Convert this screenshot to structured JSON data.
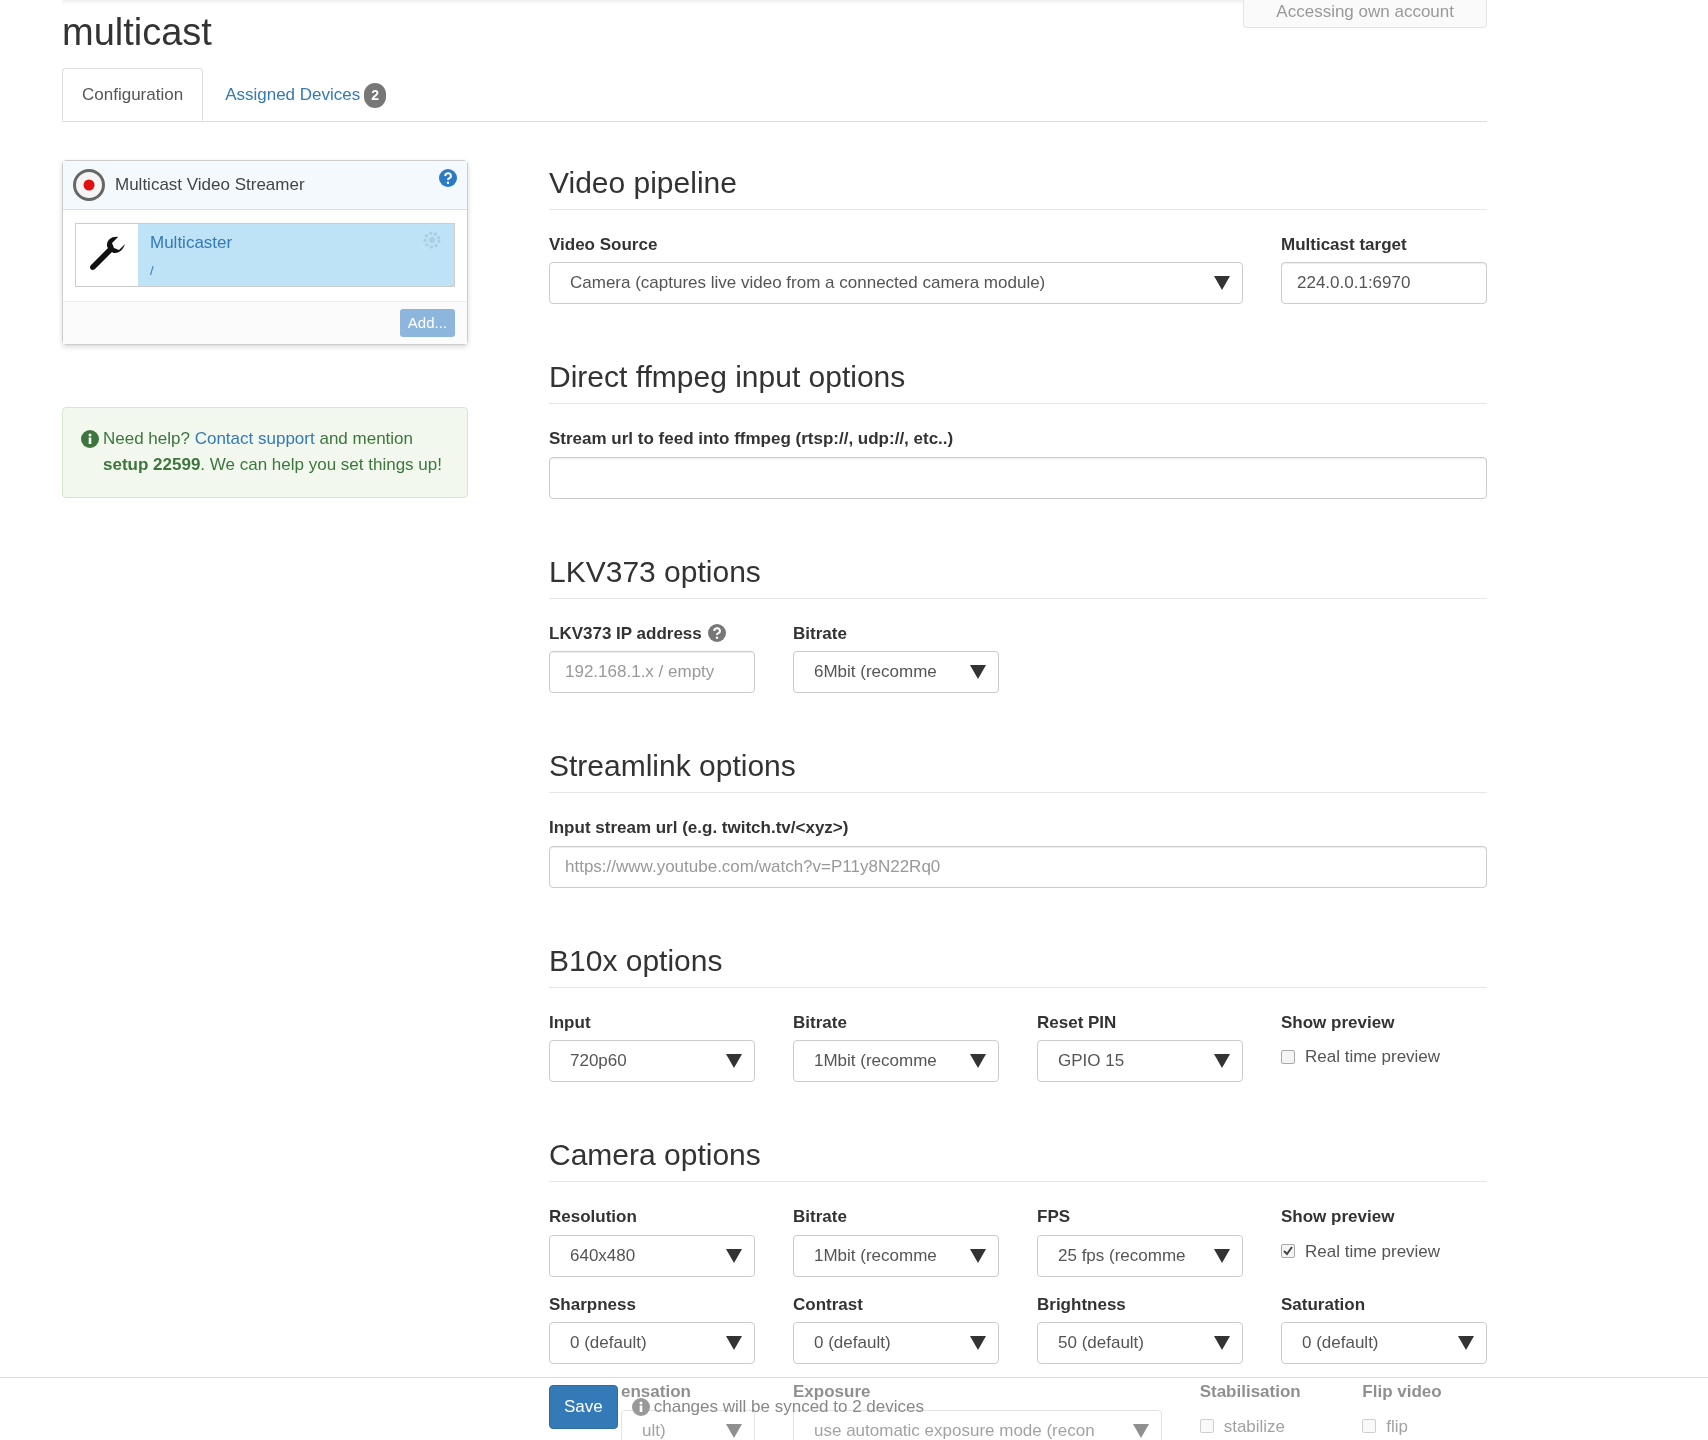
{
  "header": {
    "title": "multicast",
    "account_button": "Accessing own account"
  },
  "tabs": [
    {
      "label": "Configuration",
      "selected": true
    },
    {
      "label": "Assigned Devices",
      "badge": "2",
      "selected": false
    }
  ],
  "app_panel": {
    "title": "Multicast Video Streamer",
    "items": [
      {
        "name": "Multicaster",
        "path": "/",
        "selected": true
      }
    ],
    "add_button": "Add..."
  },
  "help": {
    "lead": "Need help?",
    "link": "Contact support",
    "rest": "and mention **setup 22599**. We can help you set things up!"
  },
  "sections": [
    {
      "title": "Video pipeline",
      "fields": [
        {
          "kind": "wide-select",
          "label": "Video Source",
          "value": "Camera (captures live video from a connected camera module)"
        },
        {
          "kind": "text",
          "label": "Multicast target",
          "value": "224.0.0.1:6970"
        }
      ]
    },
    {
      "title": "Direct ffmpeg input options",
      "fields": [
        {
          "kind": "full-text",
          "label": "Stream url to feed into ffmpeg (rtsp://, udp://, etc..)"
        }
      ]
    },
    {
      "title": "LKV373 options",
      "fields": [
        {
          "kind": "text",
          "label": "LKV373 IP address",
          "help_icon": true,
          "placeholder": "192.168.1.x / empty"
        },
        {
          "kind": "select",
          "label": "Bitrate",
          "value": "6Mbit (recomme"
        }
      ]
    },
    {
      "title": "Streamlink options",
      "fields": [
        {
          "kind": "full-text",
          "label": "Input stream url (e.g. twitch.tv/<xyz>)",
          "placeholder": "https://www.youtube.com/watch?v=P11y8N22Rq0"
        }
      ]
    },
    {
      "title": "B10x options",
      "fields": [
        {
          "kind": "select",
          "label": "Input",
          "value": "720p60"
        },
        {
          "kind": "select",
          "label": "Bitrate",
          "value": "1Mbit (recomme"
        },
        {
          "kind": "select",
          "label": "Reset PIN",
          "value": "GPIO 15"
        },
        {
          "kind": "checkbox",
          "label": "Show preview",
          "option": "Real time preview",
          "checked": false
        }
      ]
    },
    {
      "title": "Camera options",
      "fields": [
        {
          "kind": "select",
          "label": "Resolution",
          "value": "640x480"
        },
        {
          "kind": "select",
          "label": "Bitrate",
          "value": "1Mbit (recomme"
        },
        {
          "kind": "select",
          "label": "FPS",
          "value": "25 fps (recomme"
        },
        {
          "kind": "checkbox",
          "label": "Show preview",
          "option": "Real time preview",
          "checked": true
        },
        {
          "kind": "select",
          "label": "Sharpness",
          "value": "0 (default)"
        },
        {
          "kind": "select",
          "label": "Contrast",
          "value": "0 (default)"
        },
        {
          "kind": "select",
          "label": "Brightness",
          "value": "50 (default)"
        },
        {
          "kind": "select",
          "label": "Saturation",
          "value": "0 (default)"
        },
        {
          "kind": "select",
          "label": "ensation",
          "value": "ult)",
          "under_footer": true
        },
        {
          "kind": "wide2-select",
          "label": "Exposure",
          "value": "use automatic exposure mode (recon"
        },
        {
          "kind": "checkbox",
          "label": "Stabilisation",
          "option": "stabilize",
          "checked": false
        },
        {
          "kind": "checkbox",
          "label": "Flip video",
          "option": "flip",
          "checked": false
        }
      ]
    }
  ],
  "footer": {
    "save_button": "Save",
    "note": "changes will be synced to 2 devices"
  }
}
